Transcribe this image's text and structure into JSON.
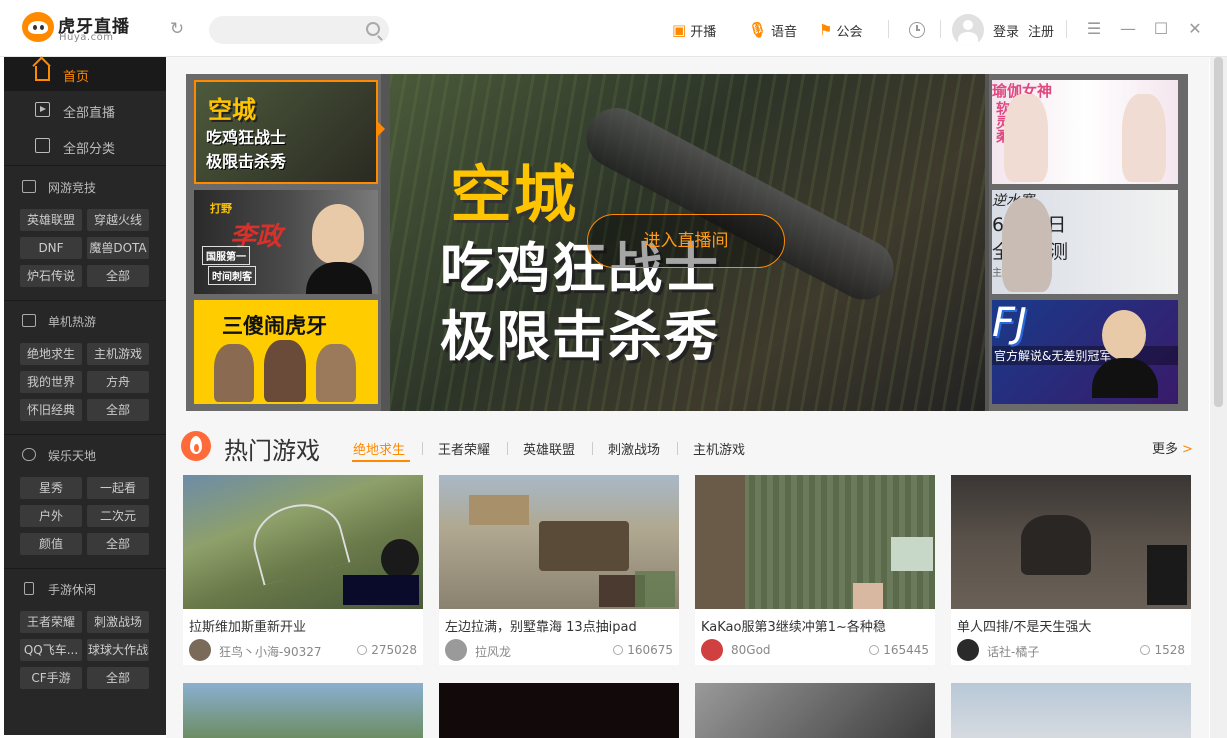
{
  "app": {
    "logo_name": "虎牙直播",
    "logo_sub": "Huya.com"
  },
  "titlebar": {
    "search_placeholder": "",
    "broadcast_label": "开播",
    "voice_label": "语音",
    "notice_label": "公会",
    "login_label": "登录",
    "register_label": "注册"
  },
  "sidebar": {
    "nav": [
      {
        "label": "首页",
        "active": true
      },
      {
        "label": "全部直播",
        "active": false
      },
      {
        "label": "全部分类",
        "active": false
      }
    ],
    "sections": [
      {
        "title": "网游竞技",
        "tags": [
          "英雄联盟",
          "穿越火线",
          "DNF",
          "魔兽DOTA",
          "炉石传说",
          "全部"
        ]
      },
      {
        "title": "单机热游",
        "tags": [
          "绝地求生",
          "主机游戏",
          "我的世界",
          "方舟",
          "怀旧经典",
          "全部"
        ]
      },
      {
        "title": "娱乐天地",
        "tags": [
          "星秀",
          "一起看",
          "户外",
          "二次元",
          "颜值",
          "全部"
        ]
      },
      {
        "title": "手游休闲",
        "tags": [
          "王者荣耀",
          "刺激战场",
          "QQ飞车...",
          "球球大作战",
          "CF手游",
          "全部"
        ]
      }
    ]
  },
  "banner": {
    "main_title_1": "空城",
    "main_title_2": "吃鸡狂战士",
    "main_title_3": "极限击杀秀",
    "enter_button": "进入直播间",
    "left_thumbs": [
      {
        "lines": [
          "空城",
          "吃鸡狂战士",
          "极限击杀秀"
        ]
      },
      {
        "lines": [
          "打野",
          "李政",
          "国服第一",
          "时间刺客"
        ]
      },
      {
        "lines": [
          "三傻闹虎牙"
        ]
      }
    ],
    "right_thumbs": [
      {
        "lines": [
          "瑜伽女神",
          "软灵柔"
        ]
      },
      {
        "lines": [
          "逆水寒",
          "6月29日",
          "全面内测",
          "主播招募"
        ]
      },
      {
        "lines": [
          "FJ",
          "官方解说&无差别冠军"
        ]
      }
    ]
  },
  "hot": {
    "title": "热门游戏",
    "tabs": [
      "绝地求生",
      "王者荣耀",
      "英雄联盟",
      "刺激战场",
      "主机游戏"
    ],
    "active_tab": 0,
    "more_label": "更多",
    "more_arrow": ">",
    "cards": [
      {
        "title": "拉斯维加斯重新开业",
        "user": "狂鸟丶小海-90327",
        "views": "275028"
      },
      {
        "title": "左边拉满，别墅靠海 13点抽ipad",
        "user": "拉风龙",
        "views": "160675"
      },
      {
        "title": "KaKao服第3继续冲第1~各种稳",
        "user": "80God",
        "views": "165445"
      },
      {
        "title": "单人四排/不是天生强大",
        "user": "话社-橘子",
        "views": "1528"
      }
    ]
  },
  "colors": {
    "accent": "#ff8a00",
    "sidebar_bg": "#272727",
    "tag_bg": "#3a3a3a"
  }
}
